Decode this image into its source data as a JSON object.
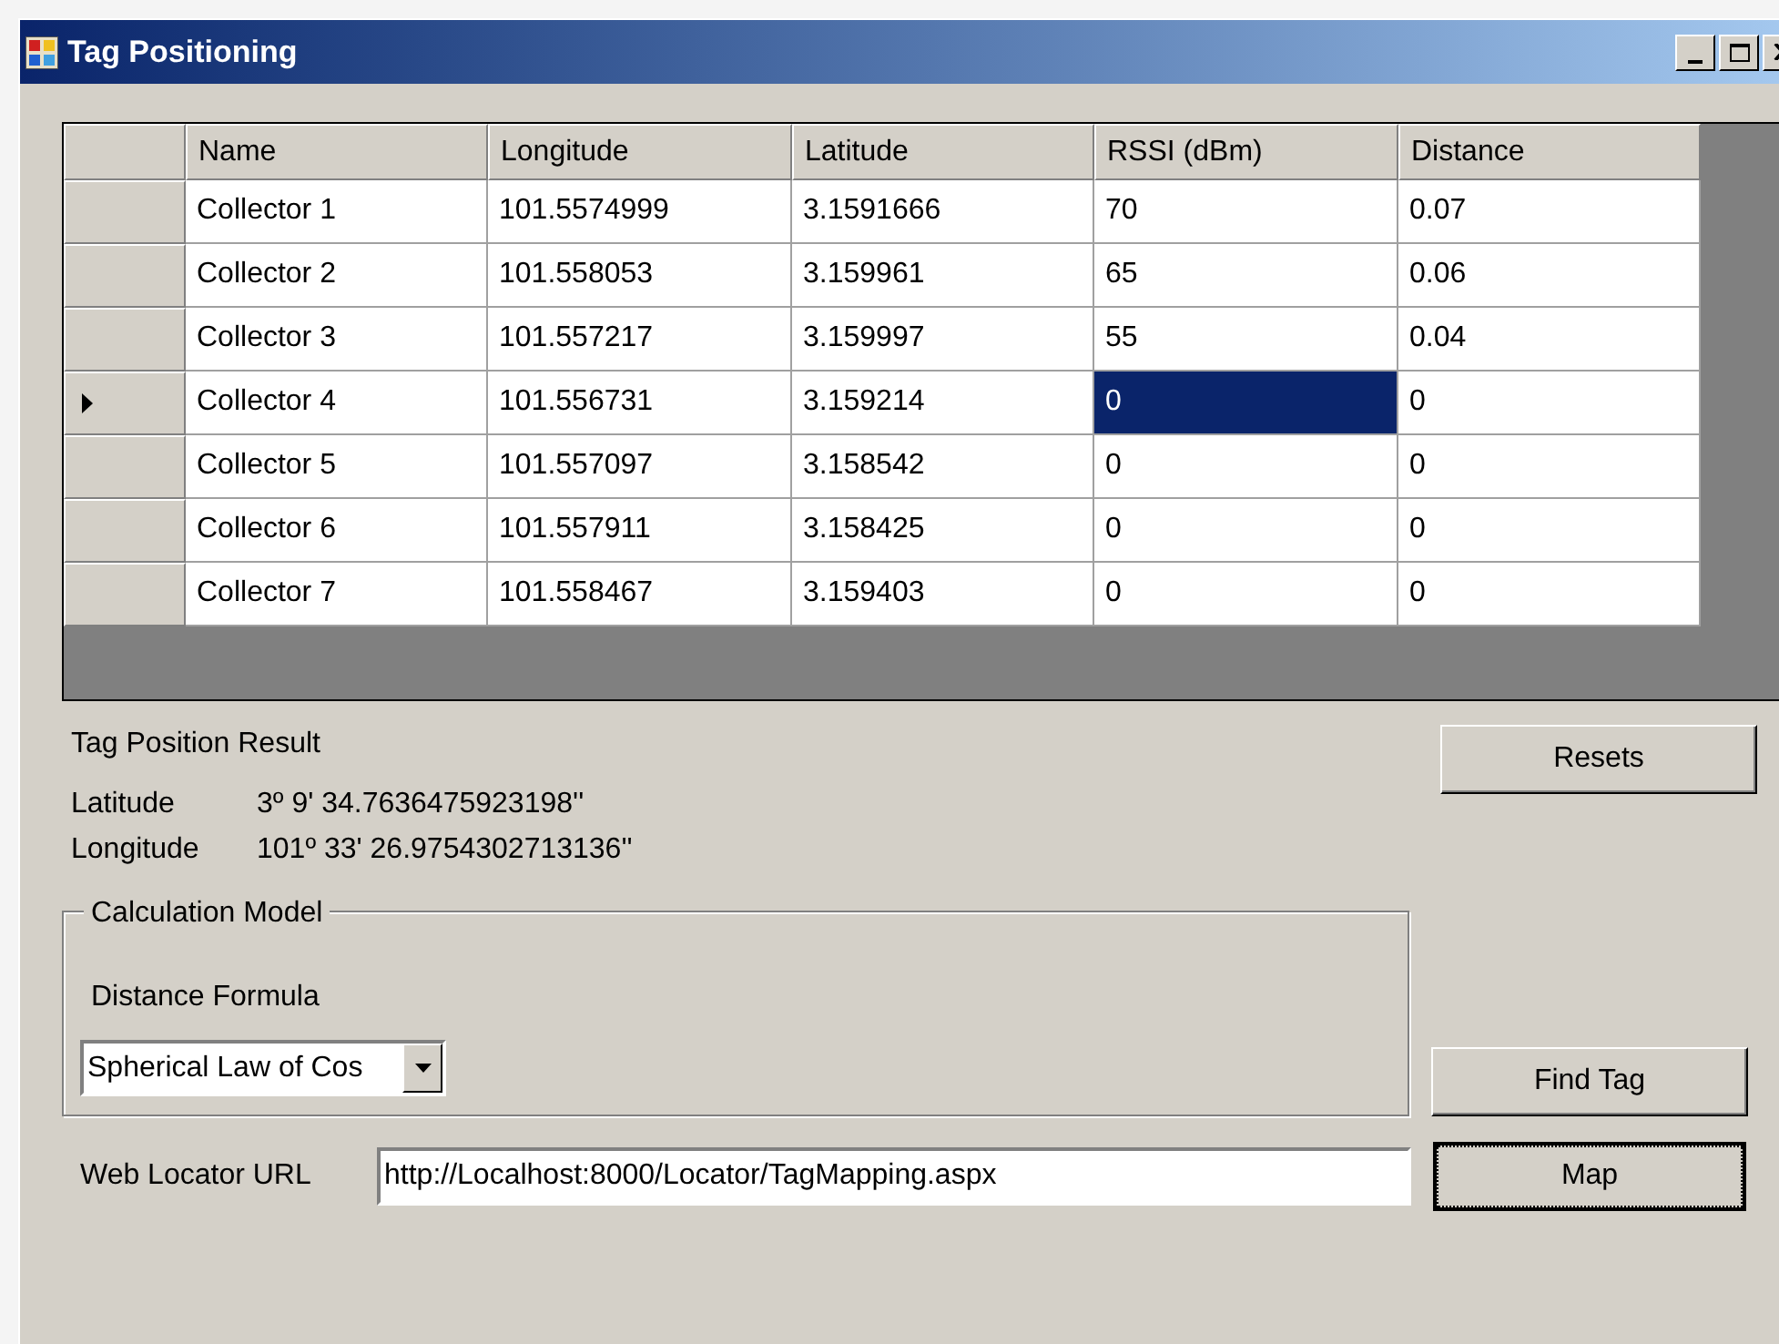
{
  "window": {
    "title": "Tag Positioning"
  },
  "grid": {
    "columns": [
      "Name",
      "Longitude",
      "Latitude",
      "RSSI (dBm)",
      "Distance"
    ],
    "rows": [
      {
        "current": false,
        "cells": [
          {
            "text": "Collector 1",
            "selected": false
          },
          {
            "text": "101.5574999",
            "selected": false
          },
          {
            "text": "3.1591666",
            "selected": false
          },
          {
            "text": "70",
            "selected": false
          },
          {
            "text": "0.07",
            "selected": false
          }
        ]
      },
      {
        "current": false,
        "cells": [
          {
            "text": "Collector 2",
            "selected": false
          },
          {
            "text": "101.558053",
            "selected": false
          },
          {
            "text": "3.159961",
            "selected": false
          },
          {
            "text": "65",
            "selected": false
          },
          {
            "text": "0.06",
            "selected": false
          }
        ]
      },
      {
        "current": false,
        "cells": [
          {
            "text": "Collector 3",
            "selected": false
          },
          {
            "text": "101.557217",
            "selected": false
          },
          {
            "text": "3.159997",
            "selected": false
          },
          {
            "text": "55",
            "selected": false
          },
          {
            "text": "0.04",
            "selected": false
          }
        ]
      },
      {
        "current": true,
        "cells": [
          {
            "text": "Collector 4",
            "selected": false
          },
          {
            "text": "101.556731",
            "selected": false
          },
          {
            "text": "3.159214",
            "selected": false
          },
          {
            "text": "0",
            "selected": true
          },
          {
            "text": "0",
            "selected": false
          }
        ]
      },
      {
        "current": false,
        "cells": [
          {
            "text": "Collector 5",
            "selected": false
          },
          {
            "text": "101.557097",
            "selected": false
          },
          {
            "text": "3.158542",
            "selected": false
          },
          {
            "text": "0",
            "selected": false
          },
          {
            "text": "0",
            "selected": false
          }
        ]
      },
      {
        "current": false,
        "cells": [
          {
            "text": "Collector 6",
            "selected": false
          },
          {
            "text": "101.557911",
            "selected": false
          },
          {
            "text": "3.158425",
            "selected": false
          },
          {
            "text": "0",
            "selected": false
          },
          {
            "text": "0",
            "selected": false
          }
        ]
      },
      {
        "current": false,
        "cells": [
          {
            "text": "Collector 7",
            "selected": false
          },
          {
            "text": "101.558467",
            "selected": false
          },
          {
            "text": "3.159403",
            "selected": false
          },
          {
            "text": "0",
            "selected": false
          },
          {
            "text": "0",
            "selected": false
          }
        ]
      }
    ]
  },
  "result": {
    "heading": "Tag Position Result",
    "latitude_label": "Latitude",
    "latitude": "3º 9' 34.7636475923198''",
    "longitude_label": "Longitude",
    "longitude": "101º 33' 26.9754302713136''"
  },
  "resets_button": "Resets",
  "calculation_model": {
    "title": "Calculation Model",
    "formula_label": "Distance Formula",
    "formula_value": "Spherical Law of Cos"
  },
  "find_tag_button": "Find Tag",
  "url": {
    "label": "Web Locator URL",
    "value": "http://Localhost:8000/Locator/TagMapping.aspx"
  },
  "map_button": {
    "label": "Map",
    "focused": true
  }
}
